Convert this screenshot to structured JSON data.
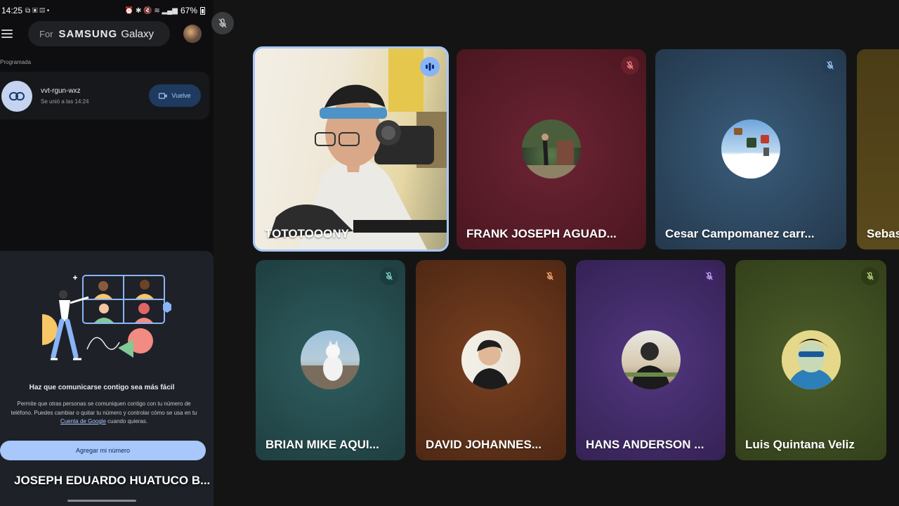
{
  "status_bar": {
    "time": "14:25",
    "battery": "67%"
  },
  "phone": {
    "promo_for": "For",
    "promo_brand": "SAMSUNG",
    "promo_product": "Galaxy",
    "section_label": "Programada",
    "meeting": {
      "code": "vvt-rgun-wxz",
      "subtitle": "Se unió a las 14:24",
      "rejoin_label": "Vuelve"
    },
    "invite": {
      "title": "Haz que comunicarse contigo sea más fácil",
      "body_before": "Permite que otras personas se comuniquen contigo con tu número de teléfono. Puedes cambiar o quitar tu número y controlar cómo se usa en tu ",
      "body_link": "Cuenta de Google",
      "body_after": " cuando quieras.",
      "button_label": "Agregar mi número"
    },
    "self_name": "JOSEPH EDUARDO HUATUCO B..."
  },
  "participants": [
    {
      "name": "TOTOTOOONY",
      "speaking": true
    },
    {
      "name": "FRANK JOSEPH AGUAD...",
      "muted": true,
      "color": "#5b1c28"
    },
    {
      "name": "Cesar Campomanez carr...",
      "muted": true,
      "color": "#2b4560"
    },
    {
      "name": "Sebas",
      "color": "#5a4a1c"
    },
    {
      "name": "BRIAN MIKE AQUI...",
      "muted": true,
      "color": "#234a4c"
    },
    {
      "name": "DAVID JOHANNES...",
      "muted": true,
      "color": "#5a3119"
    },
    {
      "name": "HANS ANDERSON ...",
      "muted": true,
      "color": "#3e2860"
    },
    {
      "name": "Luis Quintana Veliz",
      "muted": true,
      "color": "#3c4a1f"
    }
  ]
}
